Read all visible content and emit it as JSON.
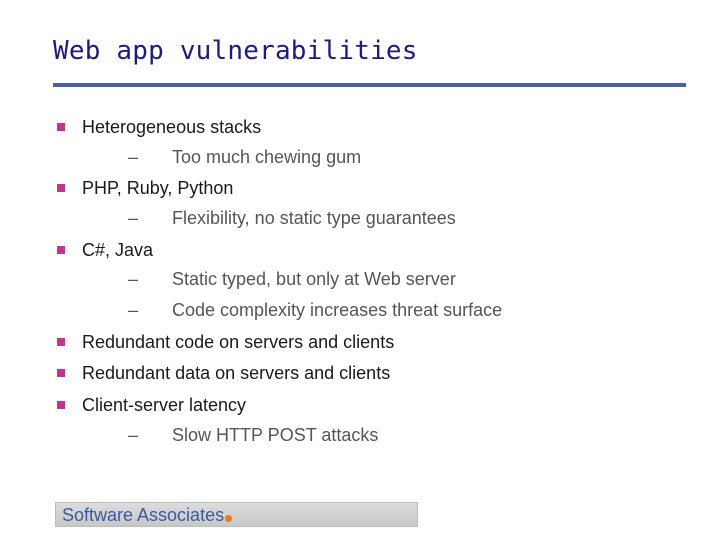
{
  "slide": {
    "title": "Web app vulnerabilities",
    "bullets": [
      {
        "text": "Heterogeneous stacks",
        "subs": [
          "Too much chewing gum"
        ]
      },
      {
        "text": "PHP, Ruby, Python",
        "subs": [
          "Flexibility, no static type guarantees"
        ]
      },
      {
        "text": "C#, Java",
        "subs": [
          "Static typed, but only at Web server",
          "Code complexity increases threat surface"
        ]
      },
      {
        "text": "Redundant code on servers and clients",
        "subs": []
      },
      {
        "text": "Redundant data on servers and clients",
        "subs": []
      },
      {
        "text": "Client-server latency",
        "subs": [
          "Slow HTTP POST attacks"
        ]
      }
    ],
    "dash_symbol": "–",
    "footer": {
      "text": "Software Associates"
    }
  },
  "colors": {
    "title": "#1a1a8c",
    "rule": "#4a5fa8",
    "bullet": "#c0358f",
    "footer_text": "#3b5aa0",
    "footer_dot": "#f07a1a"
  },
  "icons": {
    "bullet": "square-bullet-icon",
    "footer_dot": "orange-dot-icon"
  }
}
